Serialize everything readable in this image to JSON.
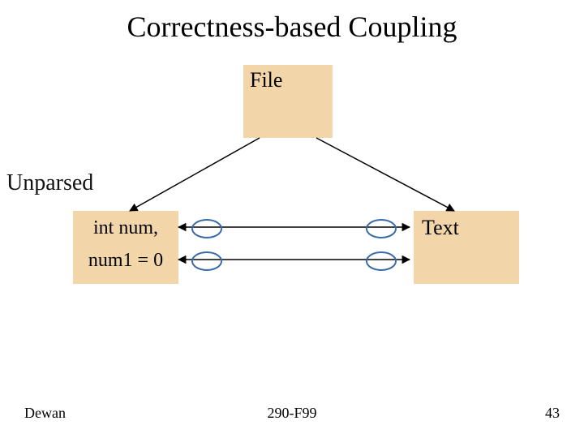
{
  "title": "Correctness-based Coupling",
  "file_box": {
    "label": "File"
  },
  "unparsed_label": "Unparsed",
  "left_box": {
    "row1": "int num,",
    "row2": "num1 = 0"
  },
  "right_box": {
    "label": "Text"
  },
  "footer": {
    "author": "Dewan",
    "course": "290-F99",
    "page": "43"
  },
  "colors": {
    "box_fill": "#f2d5a8",
    "ellipse_stroke": "#3a6aa8"
  }
}
